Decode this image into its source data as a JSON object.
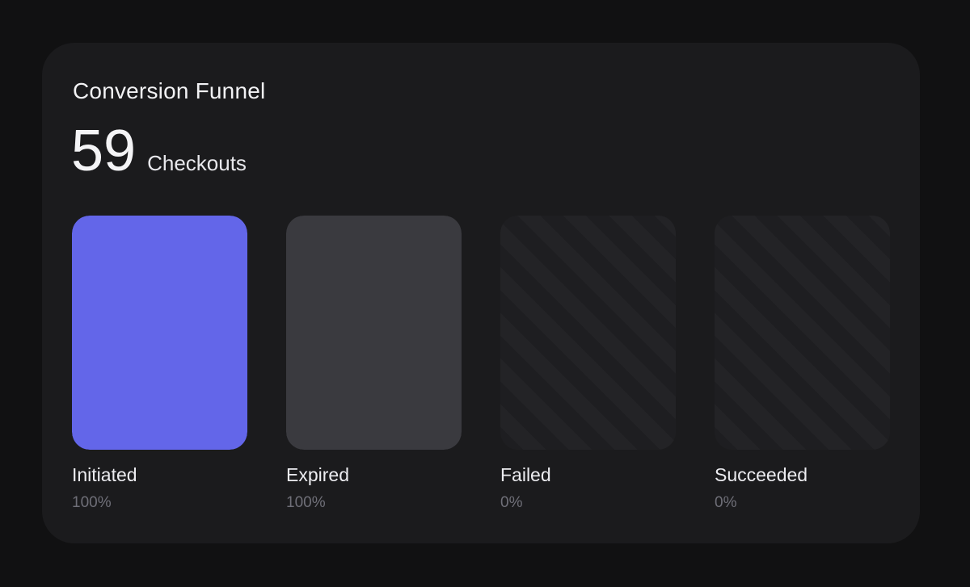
{
  "card": {
    "title": "Conversion Funnel",
    "total_value": "59",
    "total_label": "Checkouts"
  },
  "chart_data": {
    "type": "bar",
    "title": "Conversion Funnel",
    "categories": [
      "Initiated",
      "Expired",
      "Failed",
      "Succeeded"
    ],
    "values": [
      100,
      100,
      0,
      0
    ],
    "value_labels": [
      "100%",
      "100%",
      "0%",
      "0%"
    ],
    "unit": "%",
    "ylim": [
      0,
      100
    ],
    "grid": false,
    "colors": [
      "#6366e9",
      "#3a3a3f",
      "#232326",
      "#232326"
    ]
  }
}
